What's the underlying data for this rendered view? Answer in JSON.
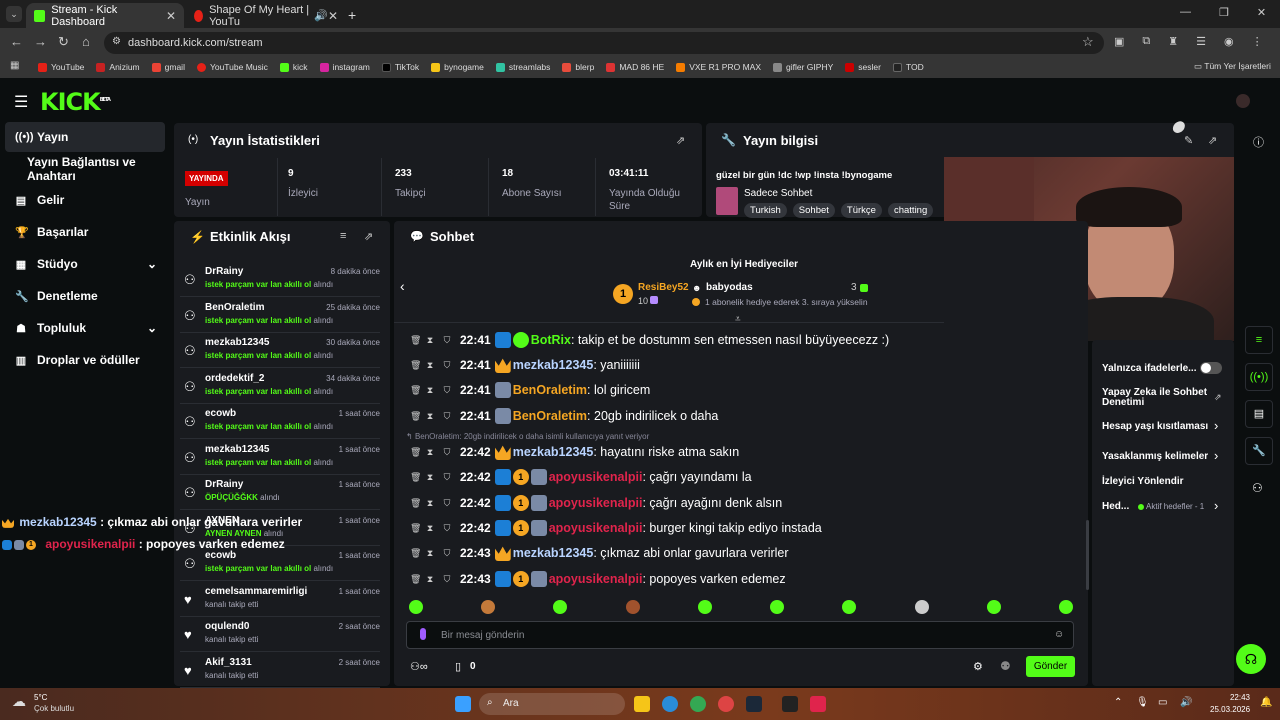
{
  "browser": {
    "tabs": [
      {
        "title": "Stream - Kick Dashboard"
      },
      {
        "title": "Shape Of My Heart | YouTu"
      }
    ],
    "url": "dashboard.kick.com/stream",
    "bookmarks": [
      "YouTube",
      "Anizium",
      "gmail",
      "YouTube Music",
      "kick",
      "instagram",
      "TikTok",
      "bynogame",
      "streamlabs",
      "blerp",
      "MAD 86 HE",
      "VXE R1 PRO MAX",
      "gifler GIPHY",
      "sesler",
      "TOD"
    ],
    "all_bookmarks": "Tüm Yer İşaretleri"
  },
  "app": {
    "logo": "KICK",
    "logo_beta": "BETA"
  },
  "sidebar": {
    "items": [
      {
        "label": "Yayın",
        "icon": "broadcast-icon"
      },
      {
        "label": "Yayın Bağlantısı ve Anahtarı",
        "icon": ""
      },
      {
        "label": "Gelir",
        "icon": "chart-icon"
      },
      {
        "label": "Başarılar",
        "icon": "trophy-icon"
      },
      {
        "label": "Stüdyo",
        "icon": "studio-icon"
      },
      {
        "label": "Denetleme",
        "icon": "wrench-icon"
      },
      {
        "label": "Topluluk",
        "icon": "community-icon"
      },
      {
        "label": "Droplar ve ödüller",
        "icon": "gift-icon"
      }
    ]
  },
  "stats": {
    "title": "Yayın İstatistikleri",
    "live_badge": "YAYINDA",
    "live_label": "Yayın",
    "viewers_value": "9",
    "viewers_label": "İzleyici",
    "followers_value": "233",
    "followers_label": "Takipçi",
    "subs_value": "18",
    "subs_label": "Abone Sayısı",
    "uptime_value": "03:41:11",
    "uptime_label": "Yayında Olduğu Süre"
  },
  "stream_info": {
    "title": "Yayın bilgisi",
    "stream_title": "güzel bir gün !dc !wp !insta !bynogame",
    "category": "Sadece Sohbet",
    "tags": [
      "Turkish",
      "Sohbet",
      "Türkçe",
      "chatting"
    ]
  },
  "activity": {
    "title": "Etkinlik Akışı",
    "items": [
      {
        "name": "DrRainy",
        "sub": "istek parçam var lan akıllı ol",
        "suffix": "alındı",
        "time": "8 dakika önce"
      },
      {
        "name": "BenOraletim",
        "sub": "istek parçam var lan akıllı ol",
        "suffix": "alındı",
        "time": "25 dakika önce"
      },
      {
        "name": "mezkab12345",
        "sub": "istek parçam var lan akıllı ol",
        "suffix": "alındı",
        "time": "30 dakika önce"
      },
      {
        "name": "ordedektif_2",
        "sub": "istek parçam var lan akıllı ol",
        "suffix": "alındı",
        "time": "34 dakika önce"
      },
      {
        "name": "ecowb",
        "sub": "istek parçam var lan akıllı ol",
        "suffix": "alındı",
        "time": "1 saat önce"
      },
      {
        "name": "mezkab12345",
        "sub": "istek parçam var lan akıllı ol",
        "suffix": "alındı",
        "time": "1 saat önce"
      },
      {
        "name": "DrRainy",
        "sub": "ÖPÜÇÜĞĞKK",
        "suffix": "alındı",
        "time": "1 saat önce"
      },
      {
        "name": "AYNEN",
        "sub": "AYNEN AYNEN",
        "suffix": "alındı",
        "time": "1 saat önce"
      },
      {
        "name": "ecowb",
        "sub": "istek parçam var lan akıllı ol",
        "suffix": "alındı",
        "time": "1 saat önce"
      },
      {
        "name": "cemelsammaremirligi",
        "sub": "kanalı takip etti",
        "suffix": "",
        "time": "1 saat önce"
      },
      {
        "name": "oqulend0",
        "sub": "kanalı takip etti",
        "suffix": "",
        "time": "2 saat önce"
      },
      {
        "name": "Akif_3131",
        "sub": "kanalı takip etti",
        "suffix": "",
        "time": "2 saat önce"
      }
    ]
  },
  "chat": {
    "title": "Sohbet",
    "gifters_title": "Aylık en İyi Hediyeciler",
    "gifter1_name": "ResiBey52",
    "gifter1_count": "10",
    "gifter2_name": "babyodas",
    "gifter2_count": "3",
    "gifter_note": "1 abonelik hediye ederek 3. sıraya yükselin",
    "reply_note": "BenOraletim: 20gb indirilicek o daha isimli kullanıcıya yanıt veriyor",
    "messages": [
      {
        "time": "22:41",
        "user": "BotRix",
        "color": "#53fc18",
        "text": ": takip et be dostumm sen etmessen nasıl büyüyeecezz :)"
      },
      {
        "time": "22:41",
        "user": "mezkab12345",
        "color": "#b9d4ff",
        "text": ": yaniiiiiii"
      },
      {
        "time": "22:41",
        "user": "BenOraletim",
        "color": "#f5a623",
        "text": ": lol giricem"
      },
      {
        "time": "22:41",
        "user": "BenOraletim",
        "color": "#f5a623",
        "text": ": 20gb indirilicek o daha"
      },
      {
        "time": "22:42",
        "user": "mezkab12345",
        "color": "#b9d4ff",
        "text": ": hayatını riske atma sakın"
      },
      {
        "time": "22:42",
        "user": "apoyusikenalpii",
        "color": "#e0244c",
        "text": ": çağrı yayındamı la"
      },
      {
        "time": "22:42",
        "user": "apoyusikenalpii",
        "color": "#e0244c",
        "text": ": çağrı ayağını denk alsın"
      },
      {
        "time": "22:42",
        "user": "apoyusikenalpii",
        "color": "#e0244c",
        "text": ": burger kingi takip ediyo instada"
      },
      {
        "time": "22:43",
        "user": "mezkab12345",
        "color": "#b9d4ff",
        "text": ": çıkmaz abi onlar gavurlara verirler"
      },
      {
        "time": "22:43",
        "user": "apoyusikenalpii",
        "color": "#e0244c",
        "text": ": popoyes varken edemez"
      }
    ],
    "input_placeholder": "Bir mesaj gönderin",
    "points": "0",
    "send": "Gönder"
  },
  "overlay": {
    "line1_user": "mezkab12345",
    "line1_text": " : çıkmaz abi onlar gavurlara verirler",
    "line2_user": "apoyusikenalpii",
    "line2_text": " : popoyes varken edemez"
  },
  "chat_settings": {
    "items": [
      "Yalnızca ifadelerle...",
      "Yapay Zeka ile Sohbet Denetimi",
      "Hesap yaşı kısıtlaması",
      "Yasaklanmış kelimeler",
      "İzleyici Yönlendir"
    ],
    "goals_label": "Hed...",
    "goals_value": "Aktif hedefler - 1"
  },
  "taskbar": {
    "weather_temp": "5°C",
    "weather_desc": "Çok bulutlu",
    "search": "Ara",
    "clock_time": "22:43",
    "clock_date": "25.03.2026"
  }
}
